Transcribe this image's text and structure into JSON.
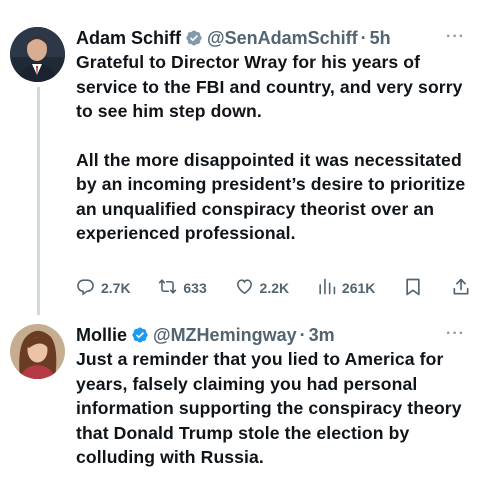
{
  "tweets": [
    {
      "name": "Adam Schiff",
      "handle": "@SenAdamSchiff",
      "separator": "·",
      "time": "5h",
      "more": "···",
      "paragraphs": [
        "Grateful to Director Wray for his years of service to the FBI and country, and very sorry to see him step down.",
        "All the more disappointed it was necessitated by an incoming president’s desire to prioritize an unqualified conspiracy theorist over an experienced professional."
      ],
      "stats": {
        "replies": "2.7K",
        "reposts": "633",
        "likes": "2.2K",
        "views": "261K"
      },
      "icons": [
        "reply-icon",
        "repost-icon",
        "like-icon",
        "views-icon",
        "bookmark-icon",
        "share-icon"
      ]
    },
    {
      "name": "Mollie",
      "handle": "@MZHemingway",
      "separator": "·",
      "time": "3m",
      "more": "···",
      "paragraphs": [
        "Just a reminder that you lied to America for years, falsely claiming you had personal information supporting the conspiracy theory that Donald Trump stole the election by colluding with Russia."
      ]
    }
  ],
  "colors": {
    "verified": "#1d9bf0",
    "text": "#0f1419",
    "muted": "#536471",
    "thread_line": "#cfd9de"
  }
}
